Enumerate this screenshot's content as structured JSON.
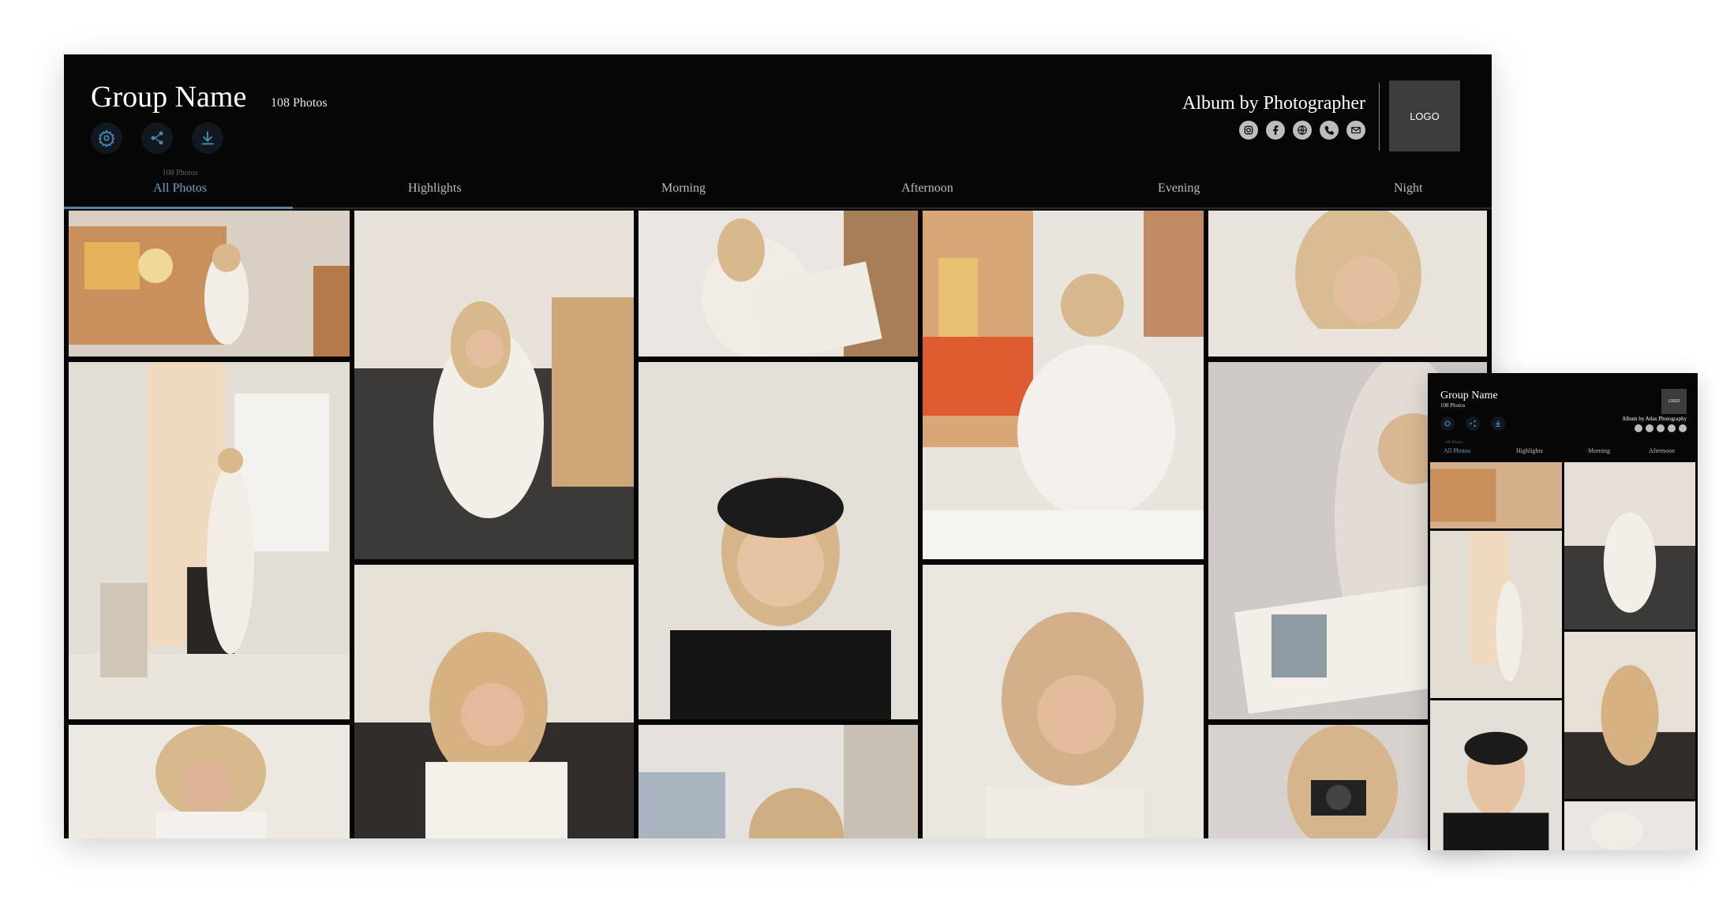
{
  "header": {
    "group_name": "Group Name",
    "photo_count": "108 Photos",
    "album_by": "Album by Photographer",
    "logo": "LOGO"
  },
  "toolbar": {
    "icons": [
      "settings-icon",
      "share-icon",
      "download-icon"
    ]
  },
  "social": [
    "instagram-icon",
    "facebook-icon",
    "website-icon",
    "phone-icon",
    "email-icon"
  ],
  "tabs": [
    {
      "label": "All Photos",
      "sub": "108 Photos",
      "active": true
    },
    {
      "label": "Highlights"
    },
    {
      "label": "Morning"
    },
    {
      "label": "Afternoon"
    },
    {
      "label": "Evening"
    },
    {
      "label": "Night"
    }
  ],
  "accent_color": "#6aa3c8",
  "mini": {
    "group_name": "Group Name",
    "photo_count": "108 Photos",
    "album_by": "Album by Atlas Photography",
    "logo": "LOGO",
    "tabs": [
      "All Photos",
      "Highlights",
      "Morning",
      "Afternoon"
    ],
    "tab_sub": "108 Photos"
  }
}
